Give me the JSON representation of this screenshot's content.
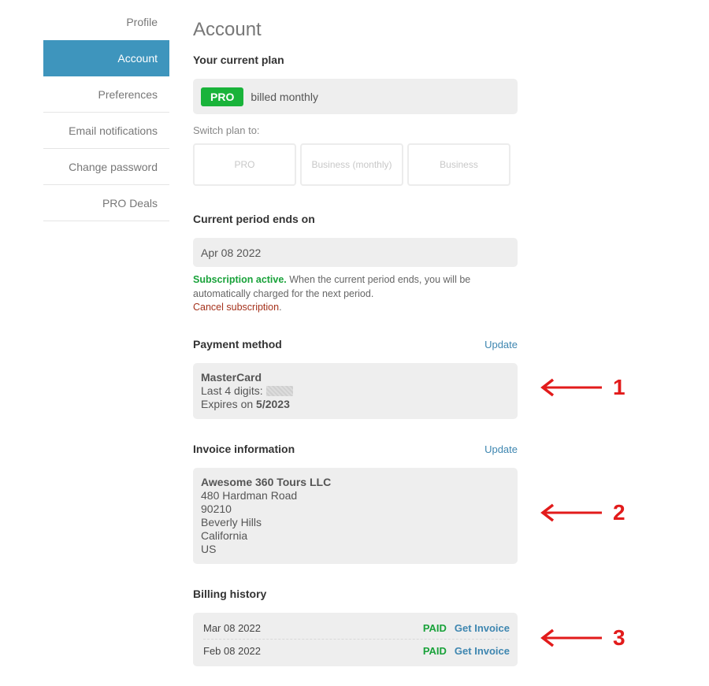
{
  "sidebar": {
    "items": [
      {
        "label": "Profile"
      },
      {
        "label": "Account"
      },
      {
        "label": "Preferences"
      },
      {
        "label": "Email notifications"
      },
      {
        "label": "Change password"
      },
      {
        "label": "PRO Deals"
      }
    ]
  },
  "page": {
    "title": "Account"
  },
  "plan": {
    "heading": "Your current plan",
    "badge": "PRO",
    "billing": "billed monthly",
    "switch_label": "Switch plan to:",
    "options": [
      "PRO",
      "Business (monthly)",
      "Business"
    ]
  },
  "period": {
    "heading": "Current period ends on",
    "date": "Apr 08 2022",
    "status_active": "Subscription active.",
    "status_text": " When the current period ends, you will be automatically charged for the next period.",
    "cancel_link": "Cancel subscription",
    "cancel_suffix": "."
  },
  "payment": {
    "heading": "Payment method",
    "update_link": "Update",
    "card": "MasterCard",
    "last4_label": "Last 4 digits:",
    "expires_label": "Expires on",
    "expires_value": "5/2023"
  },
  "invoice": {
    "heading": "Invoice information",
    "update_link": "Update",
    "company": "Awesome 360 Tours LLC",
    "lines": [
      "480 Hardman Road",
      "90210",
      "Beverly Hills",
      "California",
      "US"
    ]
  },
  "billing": {
    "heading": "Billing history",
    "rows": [
      {
        "date": "Mar 08 2022",
        "status": "PAID",
        "action": "Get Invoice"
      },
      {
        "date": "Feb 08 2022",
        "status": "PAID",
        "action": "Get Invoice"
      }
    ]
  },
  "annotations": [
    "1",
    "2",
    "3"
  ],
  "colors": {
    "accent": "#3e95bd",
    "badge_green": "#19b33a",
    "cancel_red": "#a5321c",
    "annotation_red": "#e21b1b"
  }
}
